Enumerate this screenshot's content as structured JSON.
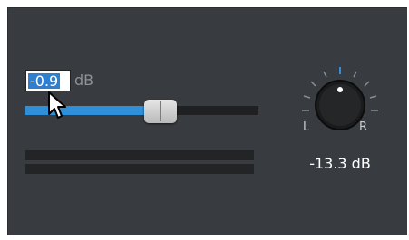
{
  "gain": {
    "value": "-0.9",
    "unit": "dB",
    "slider_level": 0.58
  },
  "pan": {
    "left_label": "L",
    "right_label": "R",
    "value": "-13.3 dB"
  },
  "colors": {
    "panel_bg": "#383b3f",
    "accent": "#2f8fd8",
    "selection": "#2f7fd0"
  },
  "icons": {
    "cursor": "mouse-pointer-icon"
  }
}
